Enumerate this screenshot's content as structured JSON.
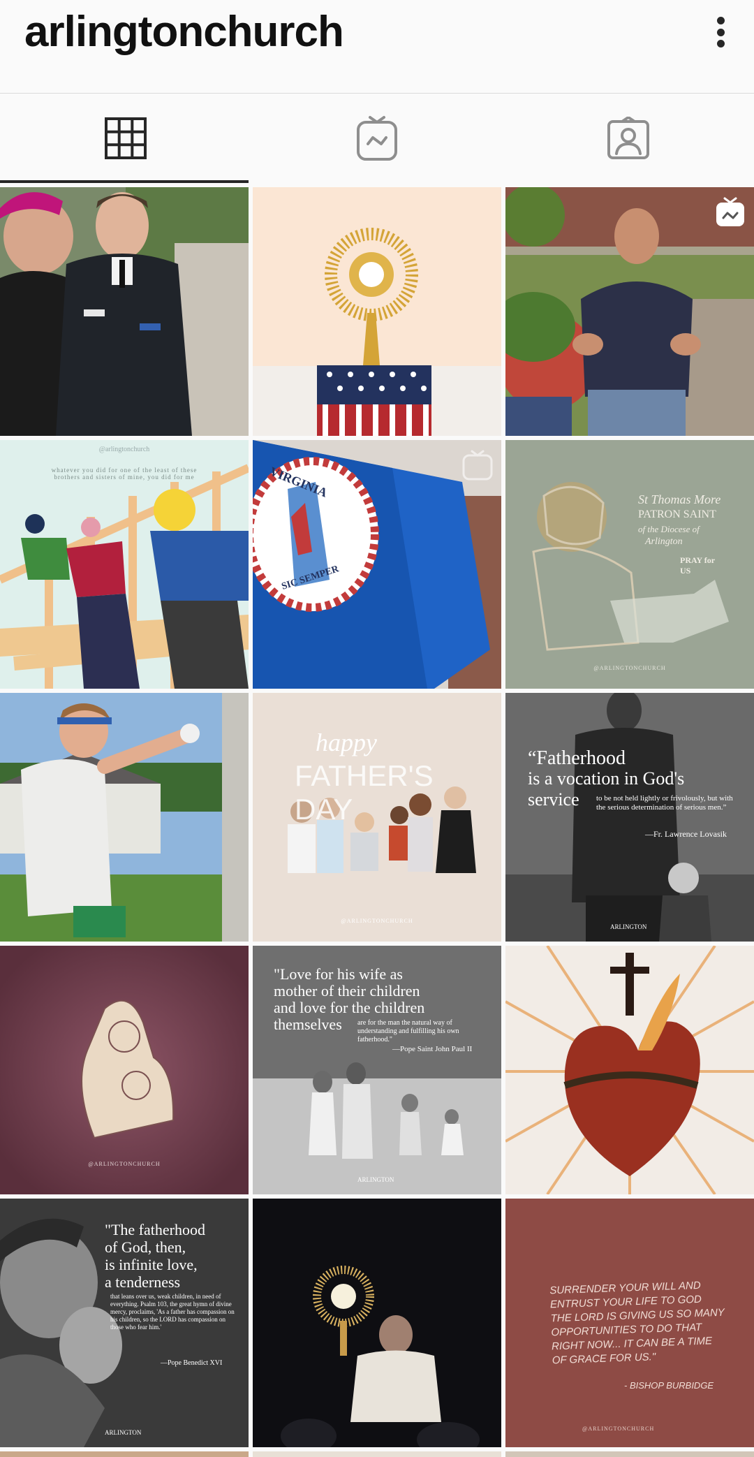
{
  "header": {
    "username": "arlingtonchurch"
  },
  "tabs": [
    {
      "name": "grid",
      "icon": "grid-icon",
      "active": true
    },
    {
      "name": "igtv",
      "icon": "igtv-icon",
      "active": false
    },
    {
      "name": "tagged",
      "icon": "tagged-icon",
      "active": false
    }
  ],
  "posts": {
    "p4_handle": "@arlingtonchurch",
    "p4_quote": "whatever you did for one of the least of these brothers and sisters of mine, you did for me",
    "p5_flag_top": "VIRGINIA",
    "p5_flag_bottom": "SIC SEMPER",
    "p6_title_1": "St Thomas More",
    "p6_title_2": "PATRON SAINT",
    "p6_title_3": "of the Diocese of",
    "p6_title_4": "Arlington",
    "p6_pray": "PRAY for US",
    "p6_handle": "@ARLINGTONCHURCH",
    "p8_happy": "happy",
    "p8_fathers": "FATHER'S DAY",
    "p8_handle": "@ARLINGTONCHURCH",
    "p9_line1": "“Fatherhood",
    "p9_line2": "is a vocation in God's",
    "p9_line3": "service",
    "p9_small": "to be not held lightly or frivolously, but with the serious determination of serious men.”",
    "p9_attrib": "—Fr. Lawrence Lovasik",
    "p9_logo": "ARLINGTON",
    "p10_handle": "@ARLINGTONCHURCH",
    "p11_line1": "\"Love for his wife as",
    "p11_line2": "mother of their children",
    "p11_line3": "and love for the children",
    "p11_line4": "themselves",
    "p11_small": "are for the man the natural way of understanding and fulfilling his own fatherhood.\"",
    "p11_attrib": "—Pope Saint John Paul II",
    "p11_logo": "ARLINGTON",
    "p13_line1": "\"The fatherhood",
    "p13_line2": "of God, then,",
    "p13_line3": "is infinite love,",
    "p13_line4": "a tenderness",
    "p13_small": "that leans over us, weak children, in need of everything. Psalm 103, the great hymn of divine mercy, proclaims, 'As a father has compassion on his children, so the LORD has compassion on those who fear him.'",
    "p13_attrib": "—Pope Benedict XVI",
    "p13_logo": "ARLINGTON",
    "p15_quote": "SURRENDER YOUR WILL AND ENTRUST YOUR LIFE TO GOD THE LORD IS GIVING US SO MANY OPPORTUNITIES TO DO THAT RIGHT NOW... IT CAN BE A TIME OF GRACE FOR US.\"",
    "p15_attrib": "- BISHOP BURBIDGE",
    "p15_handle": "@ARLINGTONCHURCH"
  },
  "colors": {
    "accent": "#262626",
    "background": "#fafafa"
  }
}
